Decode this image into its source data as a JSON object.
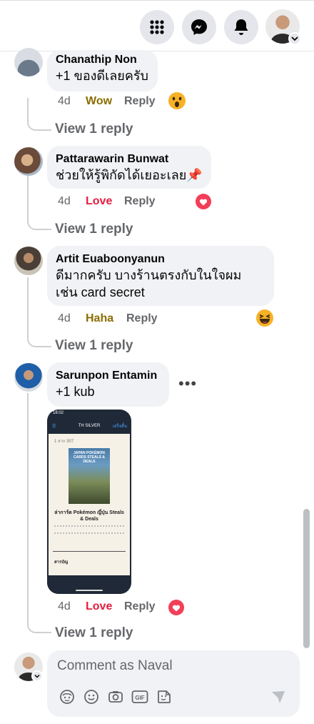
{
  "header": {
    "menu_icon": "grid-menu-icon",
    "messenger_icon": "messenger-icon",
    "notifications_icon": "bell-icon",
    "profile_badge_icon": "chevron-down-icon"
  },
  "comments": [
    {
      "author": "Chanathip Non",
      "text": "+1 ของดีเลยครับ",
      "age": "4d",
      "reaction_label": "Wow",
      "reaction_color": "#8a6d00",
      "reply_label": "Reply",
      "reaction_icon": "wow-emoji-icon",
      "view_replies": "View 1 reply"
    },
    {
      "author": "Pattarawarin Bunwat",
      "text": "ช่วยให้รู้พิกัดได้เยอะเลย📌",
      "age": "4d",
      "reaction_label": "Love",
      "reaction_color": "#e41e3f",
      "reply_label": "Reply",
      "reaction_icon": "love-heart-icon",
      "view_replies": "View 1 reply"
    },
    {
      "author": "Artit Euaboonyanun",
      "text_line1": "ดีมากครับ บางร้านตรงกับในใจผม",
      "text_line2": "เช่น card secret",
      "age": "4d",
      "reaction_label": "Haha",
      "reaction_color": "#8a6d00",
      "reply_label": "Reply",
      "reaction_icon": "haha-emoji-icon",
      "view_replies": "View 1 reply"
    },
    {
      "author": "Sarunpon Entamin",
      "text": "+1 kub",
      "more_icon": "more-options-icon",
      "age": "4d",
      "reaction_label": "Love",
      "reaction_color": "#e41e3f",
      "reply_label": "Reply",
      "reaction_icon": "love-heart-icon",
      "view_replies": "View 1 reply",
      "attachment": {
        "status_time": "18:02",
        "nav_title": "TH SILVER",
        "nav_action": "เสร็จสิ้น",
        "page_indicator": "1 จาก 307",
        "cover_title": "JAPAN POKÉMON CARDS STEALS & DEALS",
        "doc_title": "ล่าการ์ด Pokémon ญี่ปุ่น Steals & Deals",
        "toc_label": "สารบัญ"
      }
    }
  ],
  "composer": {
    "placeholder": "Comment as Naval",
    "tools": [
      "avatar-sticker-icon",
      "emoji-icon",
      "camera-icon",
      "gif-icon",
      "sticker-icon"
    ],
    "send_icon": "send-icon"
  },
  "colors": {
    "bubble_bg": "#f0f2f5",
    "meta_gray": "#65676b",
    "love_red": "#e41e3f",
    "wow_gold": "#8a6d00"
  }
}
